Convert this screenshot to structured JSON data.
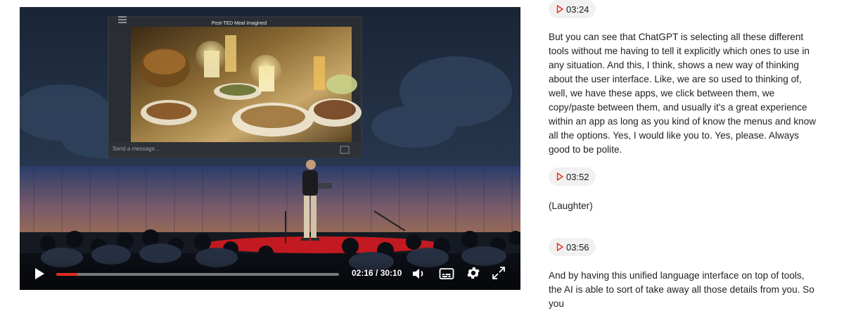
{
  "video": {
    "screen_title": "Post-TED Meal Imagined",
    "message_placeholder": "Send a message...",
    "current_time": "02:16",
    "duration": "30:10",
    "time_display": "02:16 / 30:10",
    "progress_fraction": 0.0752,
    "accent_color": "#e62b1e",
    "icons": [
      "play-icon",
      "volume-icon",
      "captions-icon",
      "gear-icon",
      "fullscreen-icon"
    ]
  },
  "transcript": {
    "segments": [
      {
        "timestamp": "03:24",
        "text": "But you can see that ChatGPT is selecting all these different tools without me having to tell it explicitly which ones to use in any situation. And this, I think, shows a new way of thinking about the user interface. Like, we are so used to thinking of, well, we have these apps, we click between them, we copy/paste between them, and usually it's a great experience within an app as long as you kind of know the menus and know all the options. Yes, I would like you to. Yes, please. Always good to be polite."
      },
      {
        "timestamp": "03:52",
        "text": "(Laughter)"
      },
      {
        "timestamp": "03:56",
        "text": "And by having this unified language interface on top of tools, the AI is able to sort of take away all those details from you. So you"
      }
    ]
  }
}
